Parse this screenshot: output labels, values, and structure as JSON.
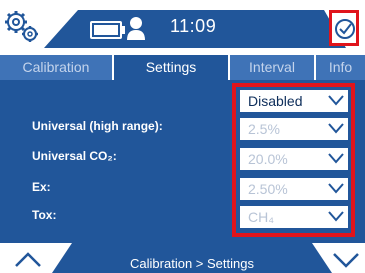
{
  "status_bar": {
    "time": "11:09",
    "icons": {
      "settings": "gears-icon",
      "battery": "battery-icon",
      "user": "user-icon",
      "confirm": "check-circle-icon"
    }
  },
  "tabs": [
    {
      "label": "Calibration",
      "active": false
    },
    {
      "label": "Settings",
      "active": true
    },
    {
      "label": "Interval",
      "active": false
    },
    {
      "label": "Info",
      "active": false
    }
  ],
  "settings": {
    "mode_dropdown": {
      "value": "Disabled"
    },
    "rows": [
      {
        "label": "Universal (high range):",
        "value": "2.5%"
      },
      {
        "label": "Universal CO₂:",
        "value": "20.0%"
      },
      {
        "label": "Ex:",
        "value": "2.50%"
      },
      {
        "label": "Tox:",
        "value": "CH₄"
      }
    ]
  },
  "footer": {
    "breadcrumb": "Calibration > Settings",
    "icons": {
      "up": "chevron-up-icon",
      "down": "chevron-down-icon"
    }
  },
  "colors": {
    "primary": "#21569a",
    "tab_bar": "#3f73b7",
    "highlight": "#e0141b",
    "disabled_text": "#b8c4d6"
  }
}
